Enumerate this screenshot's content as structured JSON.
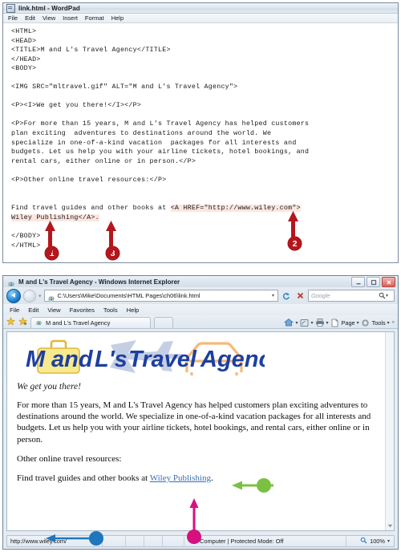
{
  "wordpad": {
    "title": "link.html - WordPad",
    "app_icon": "wordpad-icon",
    "menus": [
      "File",
      "Edit",
      "View",
      "Insert",
      "Format",
      "Help"
    ],
    "code_lines": [
      "<HTML>",
      "<HEAD>",
      "<TITLE>M and L's Travel Agency</TITLE>",
      "</HEAD>",
      "<BODY>",
      "",
      "<IMG SRC=\"mltravel.gif\" ALT=\"M and L's Travel Agency\">",
      "",
      "<P><I>We get you there!</I></P>",
      "",
      "<P>For more than 15 years, M and L's Travel Agency has helped customers",
      "plan exciting  adventures to destinations around the world. We",
      "specialize in one-of-a-kind vacation  packages for all interests and",
      "budgets. Let us help you with your airline tickets, hotel bookings, and",
      "rental cars, either online or in person.</P>",
      "",
      "<P>Other online travel resources:</P>",
      "",
      "</BODY>",
      "</HTML>"
    ],
    "link_line": {
      "prefix": "Find travel guides and other books at ",
      "anchor_open": "<A HREF=\"http://www.wiley.com\">",
      "anchor_text": "Wiley Publishing",
      "anchor_close": "</A>",
      "suffix": "."
    },
    "callouts": [
      {
        "number": "1",
        "color": "#b5161c"
      },
      {
        "number": "3",
        "color": "#b5161c"
      },
      {
        "number": "2",
        "color": "#b5161c"
      }
    ],
    "highlight_color": "#fbe6e0"
  },
  "browser": {
    "title": "M and L's Travel Agency - Windows Internet Explorer",
    "window_buttons": [
      "minimize",
      "maximize",
      "close"
    ],
    "address": "C:\\Users\\Mike\\Documents\\HTML Pages\\ch06\\link.html",
    "search_placeholder": "Google",
    "menus": [
      "File",
      "Edit",
      "View",
      "Favorites",
      "Tools",
      "Help"
    ],
    "tab_label": "M and L's Travel Agency",
    "command_bar": [
      "Page",
      "Tools"
    ],
    "status": {
      "url": "http://www.wiley.com/",
      "zone": "Computer | Protected Mode: Off",
      "zoom": "100%"
    }
  },
  "page": {
    "logo": {
      "alt": "M and L's Travel Agency",
      "word1": "M",
      "word2": "and",
      "word3": "L's",
      "word4": "Travel",
      "word5": "Agency",
      "text_color": "#1d3fa0",
      "suitcase_color": "#f7e98e",
      "plane_color": "#c5cfe4",
      "car_color": "#f5b97a"
    },
    "tagline": "We get you there!",
    "paragraphs": [
      "For more than 15 years, M and L's Travel Agency has helped customers plan exciting adventures to destinations around the world. We specialize in one-of-a-kind vacation packages for all interests and budgets. Let us help you with your airline tickets, hotel bookings, and rental cars, either online or in person.",
      "Other online travel resources:"
    ],
    "link_para_prefix": "Find travel guides and other books at ",
    "link_text": "Wiley Publishing",
    "link_para_suffix": ".",
    "link_color": "#3b6fb0"
  },
  "annotations": {
    "green_dot_color": "#7ac143",
    "blue_dot_color": "#1e76bd",
    "magenta_dot_color": "#d6117e"
  }
}
